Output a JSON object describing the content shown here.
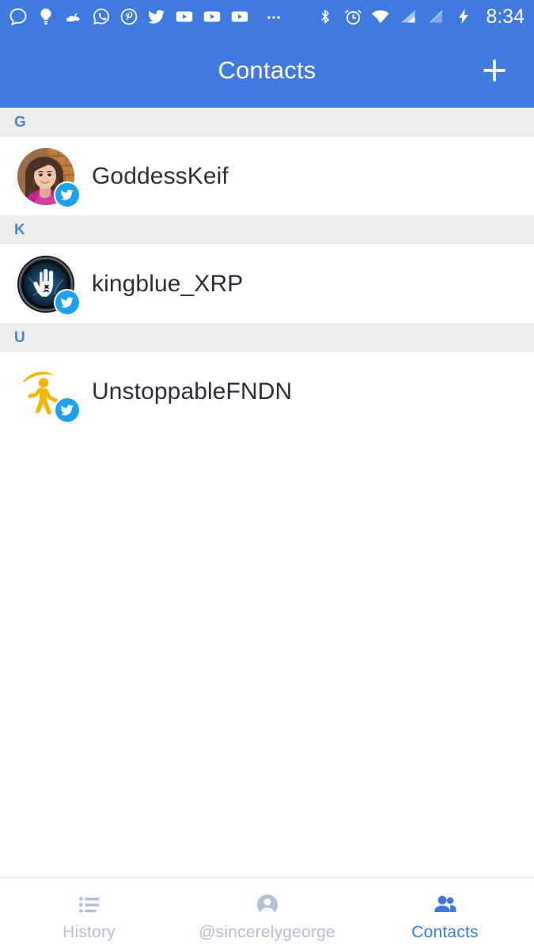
{
  "status_bar": {
    "time": "8:34",
    "left_icons": [
      "signal-messenger-icon",
      "lightbulb-icon",
      "rabbit-icon",
      "whatsapp-icon",
      "pinterest-icon",
      "twitter-icon",
      "youtube-icon-1",
      "youtube-icon-2",
      "youtube-icon-3",
      "more-notifications-icon"
    ],
    "right_icons": [
      "bluetooth-icon",
      "alarm-clock-icon",
      "wifi-icon",
      "cellular-signal-icon",
      "no-sim-icon",
      "battery-charging-icon"
    ]
  },
  "app_bar": {
    "title": "Contacts",
    "add_label": "+",
    "add_name": "add-contact-button",
    "background": "#3E7AE0",
    "text_color": "#FFFFFF"
  },
  "contacts": {
    "sections": [
      {
        "letter": "G",
        "items": [
          {
            "name": "GoddessKeif",
            "avatar": "keif-photo",
            "badge": "twitter-badge-icon"
          }
        ]
      },
      {
        "letter": "K",
        "items": [
          {
            "name": "kingblue_XRP",
            "avatar": "kingblue-logo",
            "badge": "twitter-badge-icon"
          }
        ]
      },
      {
        "letter": "U",
        "items": [
          {
            "name": "UnstoppableFNDN",
            "avatar": "unstoppable-logo",
            "badge": "twitter-badge-icon"
          }
        ]
      }
    ],
    "section_header_bg": "#EDEDED",
    "section_letter_color": "#4A86D4",
    "name_color": "#2C2F36",
    "badge_color": "#1DA1F2"
  },
  "bottom_nav": {
    "items": [
      {
        "label": "History",
        "icon": "list-history-icon",
        "active": false
      },
      {
        "label": "@sincerelygeorge",
        "icon": "person-account-icon",
        "active": false
      },
      {
        "label": "Contacts",
        "icon": "people-contacts-icon",
        "active": true
      }
    ],
    "active_color": "#3D78DC",
    "inactive_color": "#B4BED6"
  }
}
